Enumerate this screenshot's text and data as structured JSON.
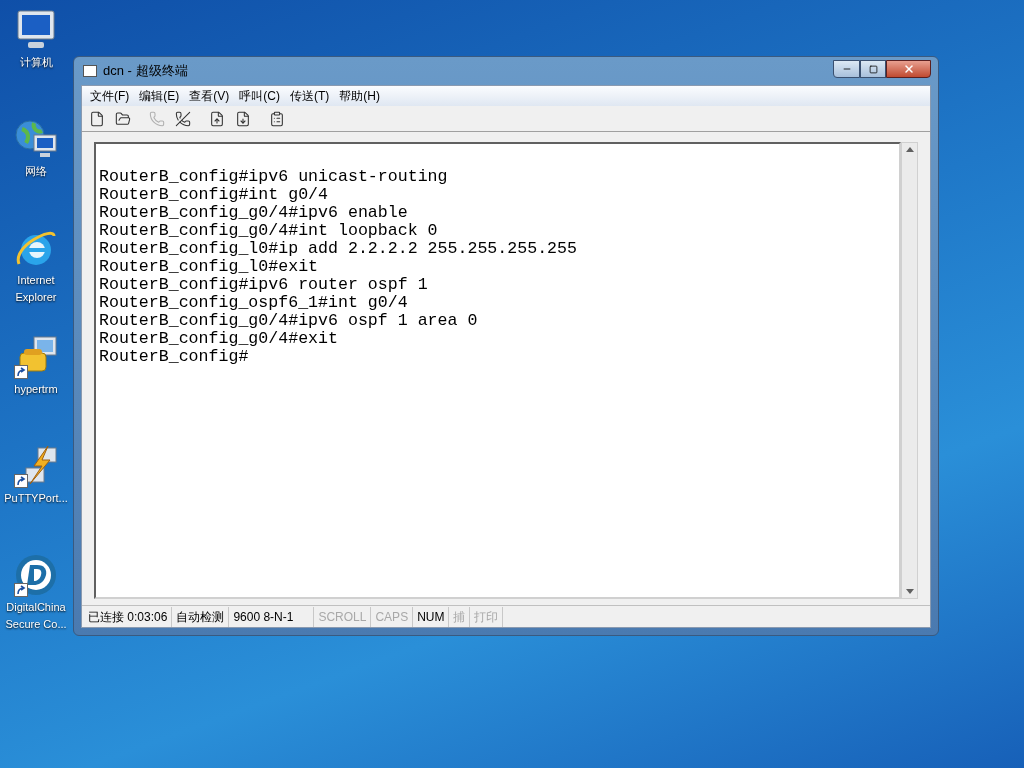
{
  "desktop_icons": [
    {
      "label": "计算机",
      "kind": "computer",
      "shortcut": false
    },
    {
      "label": "网络",
      "kind": "network",
      "shortcut": false
    },
    {
      "label": "Internet Explorer",
      "kind": "browser",
      "shortcut": false
    },
    {
      "label": "hypertrm",
      "kind": "phone",
      "shortcut": true
    },
    {
      "label": "PuTTYPort...",
      "kind": "lightning",
      "shortcut": true
    },
    {
      "label": "DigitalChina Secure Co...",
      "kind": "logo",
      "shortcut": true
    }
  ],
  "window": {
    "title": "dcn - 超级终端"
  },
  "menu": [
    "文件(F)",
    "编辑(E)",
    "查看(V)",
    "呼叫(C)",
    "传送(T)",
    "帮助(H)"
  ],
  "toolbar": [
    {
      "kind": "new",
      "disabled": false
    },
    {
      "kind": "open",
      "disabled": false
    },
    {
      "kind": "phone",
      "disabled": true
    },
    {
      "kind": "hangup",
      "disabled": false
    },
    {
      "kind": "send",
      "disabled": false
    },
    {
      "kind": "receive",
      "disabled": false
    },
    {
      "kind": "properties",
      "disabled": false
    }
  ],
  "terminal_lines": [
    "RouterB_config#ipv6 unicast-routing",
    "RouterB_config#int g0/4",
    "RouterB_config_g0/4#ipv6 enable",
    "RouterB_config_g0/4#int loopback 0",
    "RouterB_config_l0#ip add 2.2.2.2 255.255.255.255",
    "RouterB_config_l0#exit",
    "RouterB_config#ipv6 router ospf 1",
    "RouterB_config_ospf6_1#int g0/4",
    "RouterB_config_g0/4#ipv6 ospf 1 area 0",
    "RouterB_config_g0/4#exit",
    "RouterB_config#"
  ],
  "status_bar": [
    {
      "text": "已连接 0:03:06",
      "enabled": true
    },
    {
      "text": "自动检测",
      "enabled": true
    },
    {
      "text": "9600 8-N-1",
      "enabled": true
    },
    {
      "text": "SCROLL",
      "enabled": false
    },
    {
      "text": "CAPS",
      "enabled": false
    },
    {
      "text": "NUM",
      "enabled": true
    },
    {
      "text": "捕",
      "enabled": false
    },
    {
      "text": "打印",
      "enabled": false
    }
  ]
}
